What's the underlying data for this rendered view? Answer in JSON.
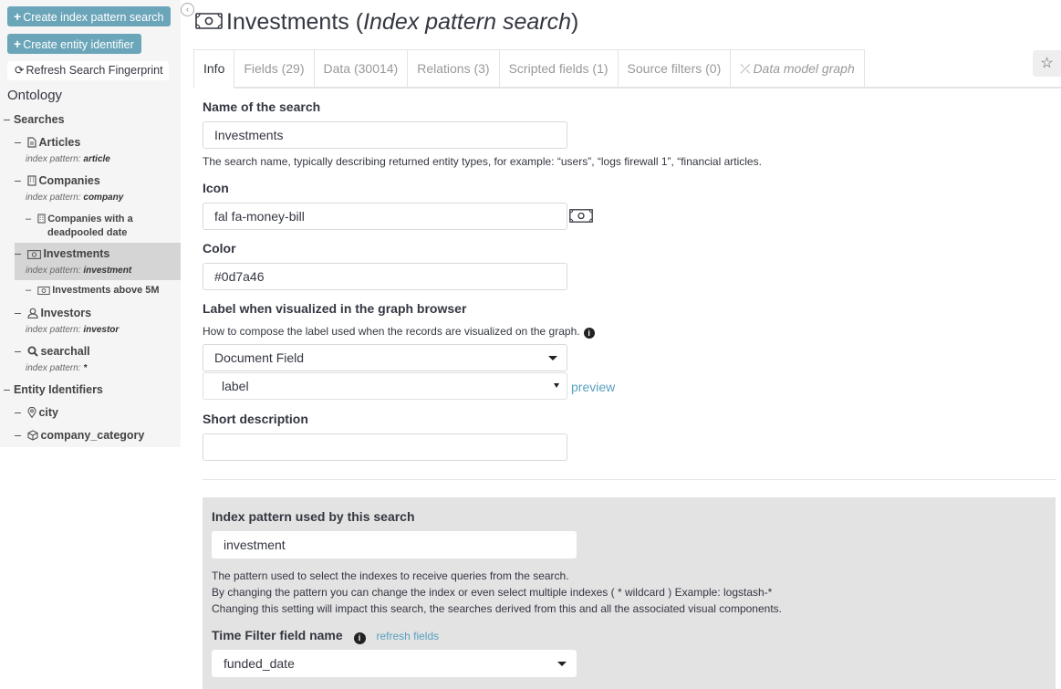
{
  "sidebar": {
    "create_search_label": "Create index pattern search",
    "create_entity_label": "Create entity identifier",
    "refresh_label": "Refresh Search Fingerprint",
    "ontology_label": "Ontology",
    "searches_label": "Searches",
    "searches": [
      {
        "label": "Articles",
        "icon": "file-icon",
        "pattern_prefix": "index pattern:",
        "pattern": "article"
      },
      {
        "label": "Companies",
        "icon": "building-icon",
        "pattern_prefix": "index pattern:",
        "pattern": "company"
      },
      {
        "label": "Companies with a",
        "label2": "deadpooled date",
        "icon": "building-icon"
      },
      {
        "label": "Investments",
        "icon": "money-bill-icon",
        "pattern_prefix": "index pattern:",
        "pattern": "investment",
        "selected": true
      },
      {
        "label": "Investments above 5M",
        "icon": "money-bill-icon"
      },
      {
        "label": "Investors",
        "icon": "user-icon",
        "pattern_prefix": "index pattern:",
        "pattern": "investor"
      },
      {
        "label": "searchall",
        "icon": "search-icon",
        "pattern_prefix": "index pattern:",
        "pattern": "*"
      }
    ],
    "entity_identifiers_label": "Entity Identifiers",
    "entity_identifiers": [
      {
        "label": "city",
        "icon": "map-marker-icon"
      },
      {
        "label": "company_category",
        "icon": "cube-icon"
      }
    ]
  },
  "header": {
    "title": "Investments",
    "subtitle": "Index pattern search",
    "icon": "money-bill-icon"
  },
  "tabs": [
    {
      "label": "Info",
      "active": true
    },
    {
      "label": "Fields (29)"
    },
    {
      "label": "Data (30014)"
    },
    {
      "label": "Relations (3)"
    },
    {
      "label": "Scripted fields (1)"
    },
    {
      "label": "Source filters (0)"
    },
    {
      "label": "Data model graph",
      "icon": "graph-icon"
    }
  ],
  "form": {
    "name_label": "Name of the search",
    "name_value": "Investments",
    "name_help": "The search name, typically describing returned entity types, for example: “users”, “logs firewall 1”, “financial articles.",
    "icon_label": "Icon",
    "icon_value": "fal fa-money-bill",
    "color_label": "Color",
    "color_value": "#0d7a46",
    "graph_label_label": "Label when visualized in the graph browser",
    "graph_label_help": "How to compose the label used when the records are visualized on the graph.",
    "label_type_value": "Document Field",
    "label_field_value": "label",
    "preview_link": "preview",
    "short_desc_label": "Short description",
    "short_desc_value": ""
  },
  "index_panel": {
    "pattern_label": "Index pattern used by this search",
    "pattern_value": "investment",
    "help_line1": "The pattern used to select the indexes to receive queries from the search.",
    "help_line2": "By changing the pattern you can change the index or even select multiple indexes ( * wildcard ) Example: logstash-*",
    "help_line3": "Changing this setting will impact this search, the searches derived from this and all the associated visual components.",
    "time_field_label": "Time Filter field name",
    "refresh_fields_link": "refresh fields",
    "time_field_value": "funded_date"
  }
}
